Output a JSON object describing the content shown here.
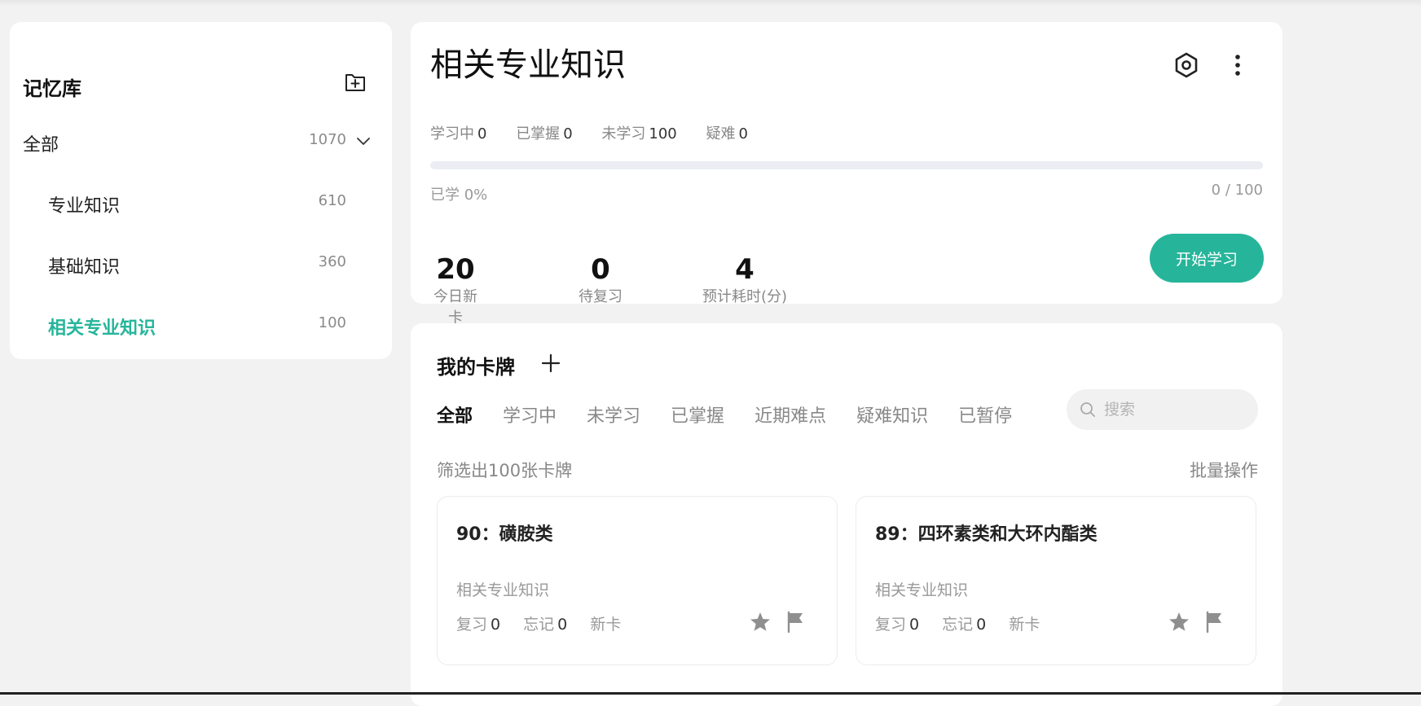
{
  "sidebar": {
    "title": "记忆库",
    "add_icon": "folder-plus-icon",
    "items": [
      {
        "label": "全部",
        "count": "1070"
      },
      {
        "label": "专业知识",
        "count": "610"
      },
      {
        "label": "基础知识",
        "count": "360"
      },
      {
        "label": "相关专业知识",
        "count": "100"
      }
    ]
  },
  "deck": {
    "title": "相关专业知识",
    "stats": [
      {
        "label": "学习中",
        "value": "0"
      },
      {
        "label": "已掌握",
        "value": "0"
      },
      {
        "label": "未学习",
        "value": "100"
      },
      {
        "label": "疑难",
        "value": "0"
      }
    ],
    "progress": 0,
    "learned_label": "已学 0%",
    "ratio": "0 / 100",
    "metrics": [
      {
        "value": "20",
        "label": "今日新卡"
      },
      {
        "value": "0",
        "label": "待复习"
      },
      {
        "value": "4",
        "label": "预计耗时(分)"
      }
    ],
    "start_label": "开始学习"
  },
  "cards_section": {
    "title": "我的卡牌",
    "tabs": [
      "全部",
      "学习中",
      "未学习",
      "已掌握",
      "近期难点",
      "疑难知识",
      "已暂停"
    ],
    "active_tab": 0,
    "search_placeholder": "搜索",
    "filter_info": "筛选出100张卡牌",
    "batch_label": "批量操作",
    "cards": [
      {
        "title": "90：磺胺类",
        "deck": "相关专业知识",
        "review_label": "复习",
        "review": "0",
        "forget_label": "忘记",
        "forget": "0",
        "status": "新卡"
      },
      {
        "title": "89：四环素类和大环内酯类",
        "deck": "相关专业知识",
        "review_label": "复习",
        "review": "0",
        "forget_label": "忘记",
        "forget": "0",
        "status": "新卡"
      }
    ]
  },
  "colors": {
    "accent": "#26b59a",
    "track": "#eaedf2"
  }
}
